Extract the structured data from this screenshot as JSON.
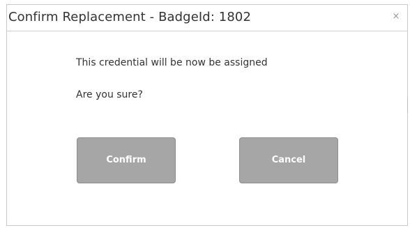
{
  "dialog": {
    "title": "Confirm Replacement - BadgeId: 1802",
    "close_glyph": "×",
    "message": "This credential will be now be assigned",
    "question": "Are you sure?",
    "confirm_label": "Confirm",
    "cancel_label": "Cancel"
  },
  "colors": {
    "button_bg": "#a6a6a6",
    "button_text": "#ffffff",
    "title_text": "#333333",
    "border": "#c9c9c9"
  }
}
